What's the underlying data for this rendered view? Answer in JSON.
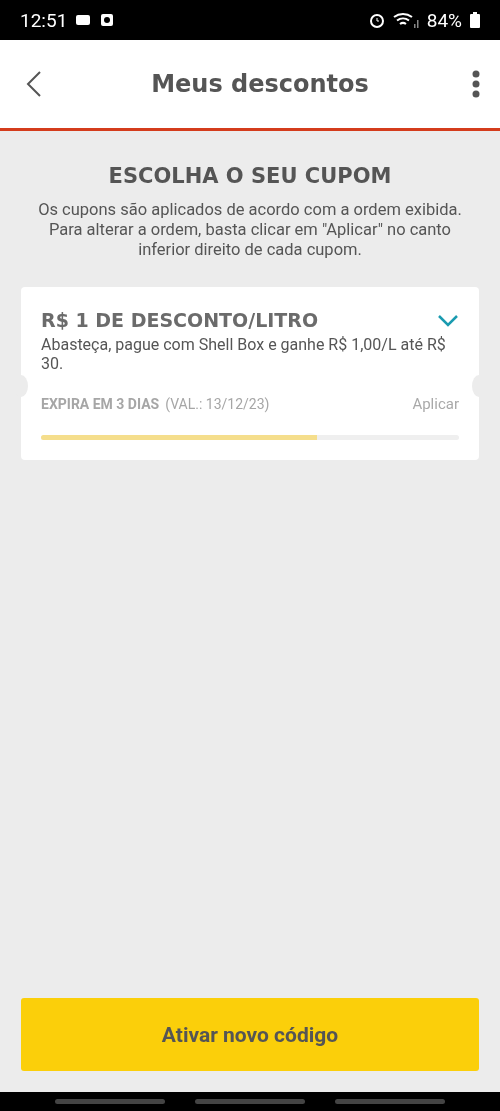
{
  "status_bar": {
    "time": "12:51",
    "battery": "84%"
  },
  "header": {
    "title": "Meus descontos"
  },
  "intro": {
    "heading": "ESCOLHA O SEU CUPOM",
    "text": "Os cupons são aplicados de acordo com a ordem exibida. Para alterar a ordem, basta clicar em \"Aplicar\" no canto inferior direito de cada cupom."
  },
  "coupons": [
    {
      "title": "R$ 1 DE DESCONTO/LITRO",
      "description": "Abasteça, pague com Shell Box e ganhe R$ 1,00/L até R$ 30.",
      "expiry": "EXPIRA EM 3 DIAS",
      "validity": "(VAL.: 13/12/23)",
      "apply": {
        "label": "Aplicar",
        "disabled": true
      },
      "level": 0.66
    }
  ],
  "primary_button": "Ativar novo código"
}
